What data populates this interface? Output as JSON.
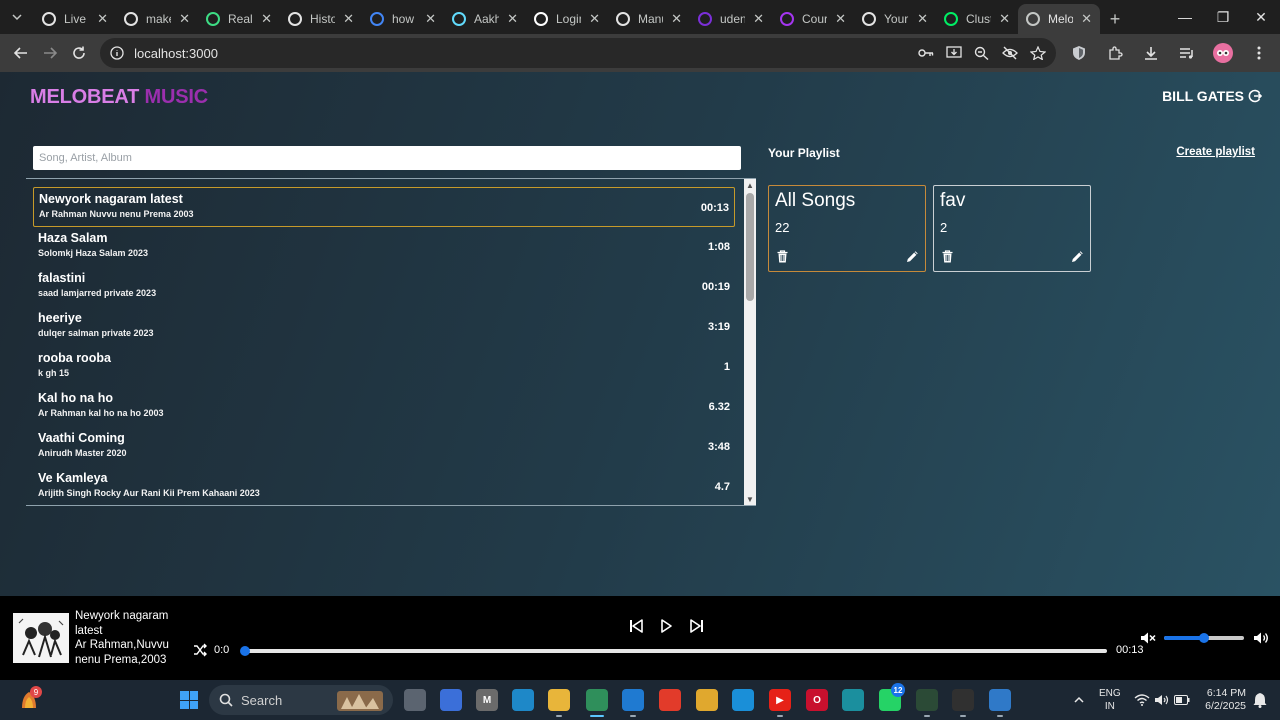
{
  "browser": {
    "tabs": [
      {
        "title": "Live S",
        "icon": "github-icon",
        "color": "#e3e3e3"
      },
      {
        "title": "make",
        "icon": "make-icon",
        "color": "#e3e3e3"
      },
      {
        "title": "Real-",
        "icon": "realtime-icon",
        "color": "#3ddc84"
      },
      {
        "title": "Histo",
        "icon": "history-icon",
        "color": "#e3e3e3"
      },
      {
        "title": "how",
        "icon": "google-icon",
        "color": "#4285f4"
      },
      {
        "title": "Aakh",
        "icon": "react-icon",
        "color": "#61dafb"
      },
      {
        "title": "Login",
        "icon": "vercel-icon",
        "color": "#ffffff"
      },
      {
        "title": "Manu",
        "icon": "github-icon",
        "color": "#e3e3e3"
      },
      {
        "title": "uden",
        "icon": "yahoo-icon",
        "color": "#7b2fd8"
      },
      {
        "title": "Cour",
        "icon": "udemy-icon",
        "color": "#a435f0"
      },
      {
        "title": "Your",
        "icon": "github-icon",
        "color": "#e3e3e3"
      },
      {
        "title": "Clust",
        "icon": "mongodb-icon",
        "color": "#00ed64"
      },
      {
        "title": "Melo",
        "icon": "globe-icon",
        "color": "#c4c7c5",
        "active": true
      }
    ],
    "url": "localhost:3000"
  },
  "app": {
    "logo_part1": "MELOBEAT",
    "logo_part2": "MUSIC",
    "user_name": "BILL GATES",
    "search_placeholder": "Song, Artist, Album",
    "songs": [
      {
        "title": "Newyork nagaram latest",
        "subtitle": "Ar Rahman Nuvvu nenu Prema 2003",
        "duration": "00:13",
        "active": true
      },
      {
        "title": "Haza Salam",
        "subtitle": "Solomkj Haza Salam 2023",
        "duration": "1:08"
      },
      {
        "title": "falastini",
        "subtitle": "saad lamjarred private 2023",
        "duration": "00:19"
      },
      {
        "title": "heeriye",
        "subtitle": "dulqer salman private 2023",
        "duration": "3:19"
      },
      {
        "title": "rooba rooba",
        "subtitle": "k gh 15",
        "duration": "1"
      },
      {
        "title": "Kal ho na ho",
        "subtitle": "Ar Rahman kal ho na ho 2003",
        "duration": "6.32"
      },
      {
        "title": "Vaathi Coming",
        "subtitle": "Anirudh Master 2020",
        "duration": "3:48"
      },
      {
        "title": "Ve Kamleya",
        "subtitle": "Arijith Singh Rocky Aur Rani Kii Prem Kahaani 2023",
        "duration": "4.7"
      }
    ],
    "playlist_heading": "Your Playlist",
    "create_playlist": "Create playlist",
    "playlists": [
      {
        "name": "All Songs",
        "count": "22",
        "active": true
      },
      {
        "name": "fav",
        "count": "2"
      }
    ]
  },
  "player": {
    "title": "Newyork nagaram latest",
    "subtitle": "Ar Rahman,Nuvvu nenu Prema,2003",
    "current_time": "0:0",
    "end_time": "00:13",
    "progress": 0,
    "volume": 0.5
  },
  "taskbar": {
    "weather_badge": "9",
    "search_label": "Search",
    "whatsapp_badge": "12",
    "lang_line1": "ENG",
    "lang_line2": "IN",
    "time": "6:14 PM",
    "date": "6/2/2025"
  }
}
